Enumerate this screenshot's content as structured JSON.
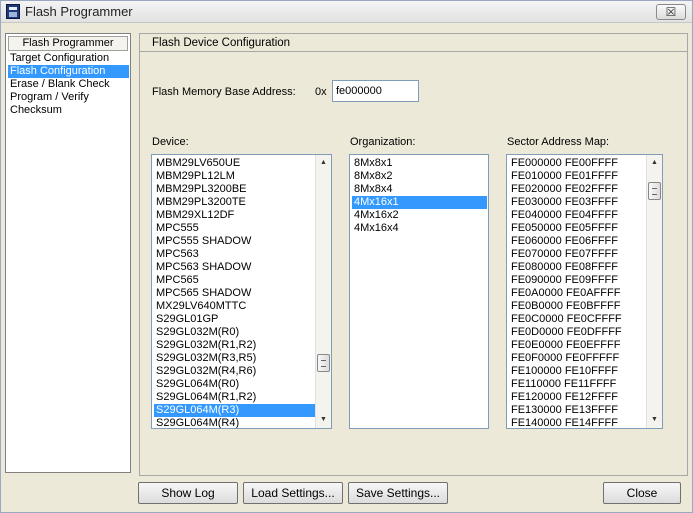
{
  "window": {
    "title": "Flash Programmer",
    "close_glyph": "☒"
  },
  "icons": {
    "app": "flash-programmer-icon",
    "close": "close-icon",
    "scroll_up": "arrow-up-icon",
    "scroll_down": "arrow-down-icon"
  },
  "nav": {
    "header": "Flash Programmer",
    "items": [
      "Target Configuration",
      "Flash Configuration",
      "Erase / Blank Check",
      "Program / Verify",
      "Checksum"
    ],
    "selected_index": 1
  },
  "config": {
    "group_title": "Flash Device Configuration",
    "base_address_label": "Flash Memory Base Address:",
    "base_address_prefix": "0x",
    "base_address_value": "fe000000",
    "device_label": "Device:",
    "organization_label": "Organization:",
    "sector_map_label": "Sector Address Map:"
  },
  "device_list": {
    "items": [
      "MBM29LV650UE",
      "MBM29PL12LM",
      "MBM29PL3200BE",
      "MBM29PL3200TE",
      "MBM29XL12DF",
      "MPC555",
      "MPC555 SHADOW",
      "MPC563",
      "MPC563 SHADOW",
      "MPC565",
      "MPC565 SHADOW",
      "MX29LV640MTTC",
      "S29GL01GP",
      "S29GL032M(R0)",
      "S29GL032M(R1,R2)",
      "S29GL032M(R3,R5)",
      "S29GL032M(R4,R6)",
      "S29GL064M(R0)",
      "S29GL064M(R1,R2)",
      "S29GL064M(R3)",
      "S29GL064M(R4)"
    ],
    "selected": "S29GL064M(R3)",
    "scroll_position": 0.82
  },
  "organization_list": {
    "items": [
      "8Mx8x1",
      "8Mx8x2",
      "8Mx8x4",
      "4Mx16x1",
      "4Mx16x2",
      "4Mx16x4"
    ],
    "selected": "4Mx16x1"
  },
  "sector_map": {
    "items": [
      "FE000000  FE00FFFF",
      "FE010000  FE01FFFF",
      "FE020000  FE02FFFF",
      "FE030000  FE03FFFF",
      "FE040000  FE04FFFF",
      "FE050000  FE05FFFF",
      "FE060000  FE06FFFF",
      "FE070000  FE07FFFF",
      "FE080000  FE08FFFF",
      "FE090000  FE09FFFF",
      "FE0A0000  FE0AFFFF",
      "FE0B0000  FE0BFFFF",
      "FE0C0000  FE0CFFFF",
      "FE0D0000  FE0DFFFF",
      "FE0E0000  FE0EFFFF",
      "FE0F0000  FE0FFFFF",
      "FE100000  FE10FFFF",
      "FE110000  FE11FFFF",
      "FE120000  FE12FFFF",
      "FE130000  FE13FFFF",
      "FE140000  FE14FFFF"
    ],
    "scroll_position": 0.05
  },
  "buttons": {
    "show_log": "Show Log",
    "load_settings": "Load Settings...",
    "save_settings": "Save Settings...",
    "close": "Close"
  },
  "colors": {
    "selection": "#3399ff",
    "face": "#ece9d8",
    "list_border": "#7f9db9"
  }
}
